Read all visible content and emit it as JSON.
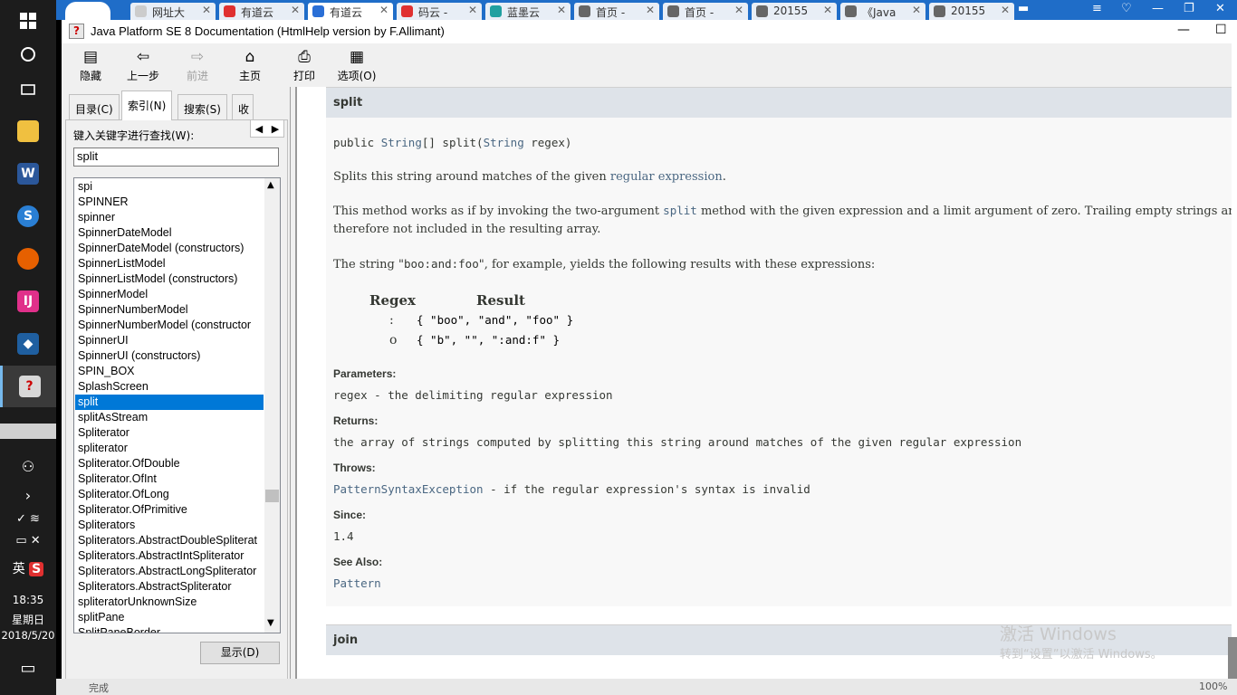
{
  "taskbar": {
    "clock_time": "18:35",
    "clock_day": "星期日",
    "clock_date": "2018/5/20",
    "ime_label": "英"
  },
  "browser_tabs": [
    {
      "label": "网址大",
      "icon_color": "#cccccc"
    },
    {
      "label": "有道云",
      "icon_color": "#e03030"
    },
    {
      "label": "有道云",
      "icon_color": "#2a6fd6"
    },
    {
      "label": "码云 -",
      "icon_color": "#e03030"
    },
    {
      "label": "蓝墨云",
      "icon_color": "#20a0a0"
    },
    {
      "label": "首页 -",
      "icon_color": "#666666"
    },
    {
      "label": "首页 -",
      "icon_color": "#666666"
    },
    {
      "label": "20155",
      "icon_color": "#666666"
    },
    {
      "label": "《Java",
      "icon_color": "#666666"
    },
    {
      "label": "20155",
      "icon_color": "#666666"
    }
  ],
  "window": {
    "title": "Java Platform SE 8 Documentation (HtmlHelp version by F.Allimant)"
  },
  "toolbar": {
    "hide": "隐藏",
    "back": "上一步",
    "forward": "前进",
    "home": "主页",
    "print": "打印",
    "options": "选项(O)"
  },
  "nav": {
    "tabs": [
      "目录(C)",
      "索引(N)",
      "搜索(S)",
      "收"
    ],
    "keyword_label": "键入关键字进行查找(W):",
    "keyword_value": "split",
    "display_button": "显示(D)",
    "index_items": [
      "spi",
      "SPINNER",
      "spinner",
      "SpinnerDateModel",
      "SpinnerDateModel (constructors)",
      "SpinnerListModel",
      "SpinnerListModel (constructors)",
      "SpinnerModel",
      "SpinnerNumberModel",
      "SpinnerNumberModel (constructor",
      "SpinnerUI",
      "SpinnerUI (constructors)",
      "SPIN_BOX",
      "SplashScreen",
      "split",
      "splitAsStream",
      "Spliterator",
      "spliterator",
      "Spliterator.OfDouble",
      "Spliterator.OfInt",
      "Spliterator.OfLong",
      "Spliterator.OfPrimitive",
      "Spliterators",
      "Spliterators.AbstractDoubleSpliterat",
      "Spliterators.AbstractIntSpliterator",
      "Spliterators.AbstractLongSpliterator",
      "Spliterators.AbstractSpliterator",
      "spliteratorUnknownSize",
      "splitPane",
      "SplitPaneBorder"
    ],
    "selected_index": 14
  },
  "doc": {
    "heading": "split",
    "sig_public": "public ",
    "sig_type": "String",
    "sig_mid": "[] split(",
    "sig_param_type": "String",
    "sig_end": " regex)",
    "p1_a": "Splits this string around matches of the given ",
    "p1_link": "regular expression",
    "p1_b": ".",
    "p2_a": "This method works as if by invoking the two-argument ",
    "p2_code": "split",
    "p2_b": " method with the given expression and a limit argument of zero. Trailing empty strings are",
    "p2_c": "therefore not included in the resulting array.",
    "p3_a": "The string \"",
    "p3_code": "boo:and:foo",
    "p3_b": "\", for example, yields the following results with these expressions:",
    "table_head_regex": "Regex",
    "table_head_result": "Result",
    "rows": [
      {
        "regex": ":",
        "result": "{ \"boo\", \"and\", \"foo\" }"
      },
      {
        "regex": "o",
        "result": "{ \"b\", \"\", \":and:f\" }"
      }
    ],
    "params_label": "Parameters:",
    "params_text": "regex - the delimiting regular expression",
    "returns_label": "Returns:",
    "returns_text": "the array of strings computed by splitting this string around matches of the given regular expression",
    "throws_label": "Throws:",
    "throws_link": "PatternSyntaxException",
    "throws_text": " - if the regular expression's syntax is invalid",
    "since_label": "Since:",
    "since_text": "1.4",
    "seealso_label": "See Also:",
    "seealso_link": "Pattern",
    "next_heading": "join"
  },
  "watermark": {
    "line1": "激活 Windows",
    "line2": "转到“设置”以激活 Windows。"
  },
  "status": {
    "text": "完成",
    "zoom": "100%"
  }
}
